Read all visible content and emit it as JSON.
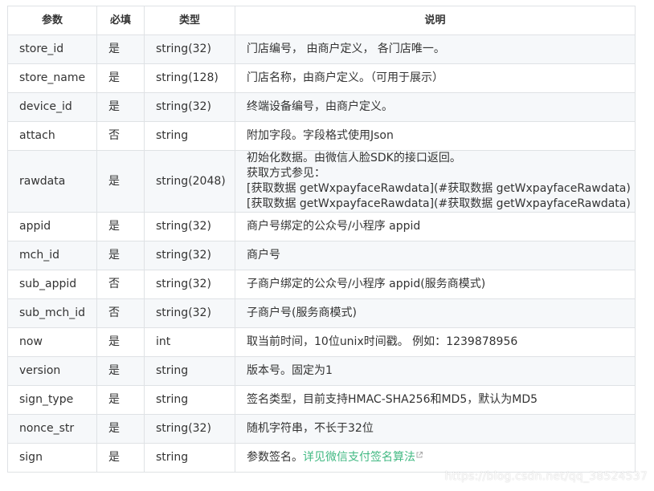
{
  "table": {
    "headers": [
      "参数",
      "必填",
      "类型",
      "说明"
    ],
    "rows": [
      {
        "param": "store_id",
        "required": "是",
        "type": "string(32)",
        "desc": "门店编号， 由商户定义， 各门店唯一。"
      },
      {
        "param": "store_name",
        "required": "是",
        "type": "string(128)",
        "desc": "门店名称，由商户定义。（可用于展示）"
      },
      {
        "param": "device_id",
        "required": "是",
        "type": "string(32)",
        "desc": "终端设备编号，由商户定义。"
      },
      {
        "param": "attach",
        "required": "否",
        "type": "string",
        "desc": "附加字段。字段格式使用Json"
      },
      {
        "param": "rawdata",
        "required": "是",
        "type": "string(2048)",
        "desc_lines": [
          "初始化数据。由微信人脸SDK的接口返回。",
          "获取方式参见：",
          "[获取数据 getWxpayfaceRawdata](#获取数据 getWxpayfaceRawdata)",
          "[获取数据 getWxpayfaceRawdata](#获取数据 getWxpayfaceRawdata)"
        ]
      },
      {
        "param": "appid",
        "required": "是",
        "type": "string(32)",
        "desc": "商户号绑定的公众号/小程序 appid"
      },
      {
        "param": "mch_id",
        "required": "是",
        "type": "string(32)",
        "desc": "商户号"
      },
      {
        "param": "sub_appid",
        "required": "否",
        "type": "string(32)",
        "desc": "子商户绑定的公众号/小程序 appid(服务商模式)"
      },
      {
        "param": "sub_mch_id",
        "required": "否",
        "type": "string(32)",
        "desc": "子商户号(服务商模式)"
      },
      {
        "param": "now",
        "required": "是",
        "type": "int",
        "desc": "取当前时间，10位unix时间戳。 例如：1239878956"
      },
      {
        "param": "version",
        "required": "是",
        "type": "string",
        "desc": "版本号。固定为1"
      },
      {
        "param": "sign_type",
        "required": "是",
        "type": "string",
        "desc": "签名类型，目前支持HMAC-SHA256和MD5，默认为MD5"
      },
      {
        "param": "nonce_str",
        "required": "是",
        "type": "string(32)",
        "desc": "随机字符串，不长于32位"
      },
      {
        "param": "sign",
        "required": "是",
        "type": "string",
        "desc": "参数签名。",
        "link_text": "详见微信支付签名算法",
        "link_icon": "external-link-icon"
      }
    ]
  },
  "watermark": "https://blog.csdn.net/qq_38524537",
  "colors": {
    "border": "#dfe2e5",
    "stripe": "#f6f8fa",
    "text": "#333333",
    "link": "#42b983"
  }
}
